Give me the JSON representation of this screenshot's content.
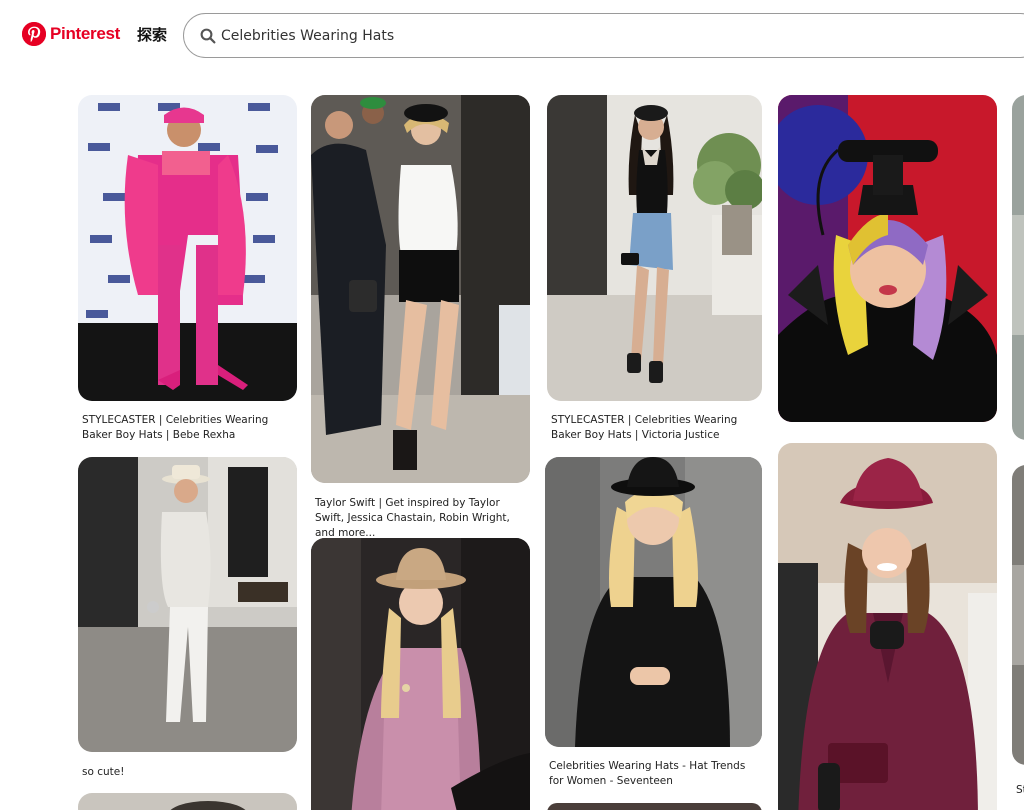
{
  "brand": {
    "name": "Pinterest",
    "color": "#e60023"
  },
  "nav": {
    "explore_label": "探索"
  },
  "search": {
    "value": "Celebrities Wearing Hats",
    "icon": "search-icon"
  },
  "pins": [
    {
      "caption": "STYLECASTER | Celebrities Wearing Baker Boy Hats | Bebe Rexha"
    },
    {
      "caption": "so cute!"
    },
    {
      "caption": "Taylor Swift | Get inspired by Taylor Swift, Jessica Chastain, Robin Wright, and more..."
    },
    {
      "caption": ""
    },
    {
      "caption": "STYLECASTER | Celebrities Wearing Baker Boy Hats | Victoria Justice"
    },
    {
      "caption": "Celebrities Wearing Hats - Hat Trends for Women - Seventeen"
    },
    {
      "caption": ""
    },
    {
      "caption": ""
    },
    {
      "caption": ""
    },
    {
      "caption": "St... Ba..."
    }
  ]
}
